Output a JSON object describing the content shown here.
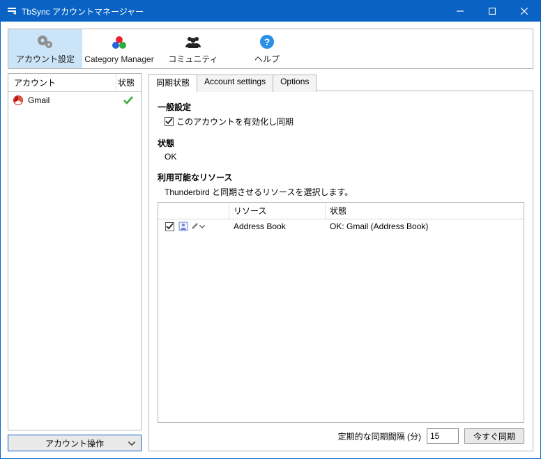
{
  "window": {
    "title": "TbSync アカウントマネージャー"
  },
  "toolbar": {
    "account_settings": "アカウント設定",
    "category_manager": "Category Manager",
    "community": "コミュニティ",
    "help": "ヘルプ"
  },
  "accounts": {
    "header_account": "アカウント",
    "header_state": "状態",
    "items": [
      {
        "name": "Gmail",
        "state": "ok"
      }
    ],
    "operations_label": "アカウント操作"
  },
  "tabs": {
    "items": [
      {
        "label": "同期状態",
        "active": true
      },
      {
        "label": "Account settings",
        "active": false
      },
      {
        "label": "Options",
        "active": false
      }
    ]
  },
  "panel": {
    "general_title": "一般設定",
    "enable_label": "このアカウントを有効化し同期",
    "state_title": "状態",
    "state_value": "OK",
    "resources_title": "利用可能なリソース",
    "resources_hint": "Thunderbird と同期させるリソースを選択します。",
    "res_header_empty": "",
    "res_header_resource": "リソース",
    "res_header_state": "状態",
    "resources": [
      {
        "checked": true,
        "name": "Address Book",
        "state": "OK: Gmail (Address Book)"
      }
    ],
    "interval_label": "定期的な同期間隔 (分)",
    "interval_value": "15",
    "sync_now": "今すぐ同期"
  }
}
